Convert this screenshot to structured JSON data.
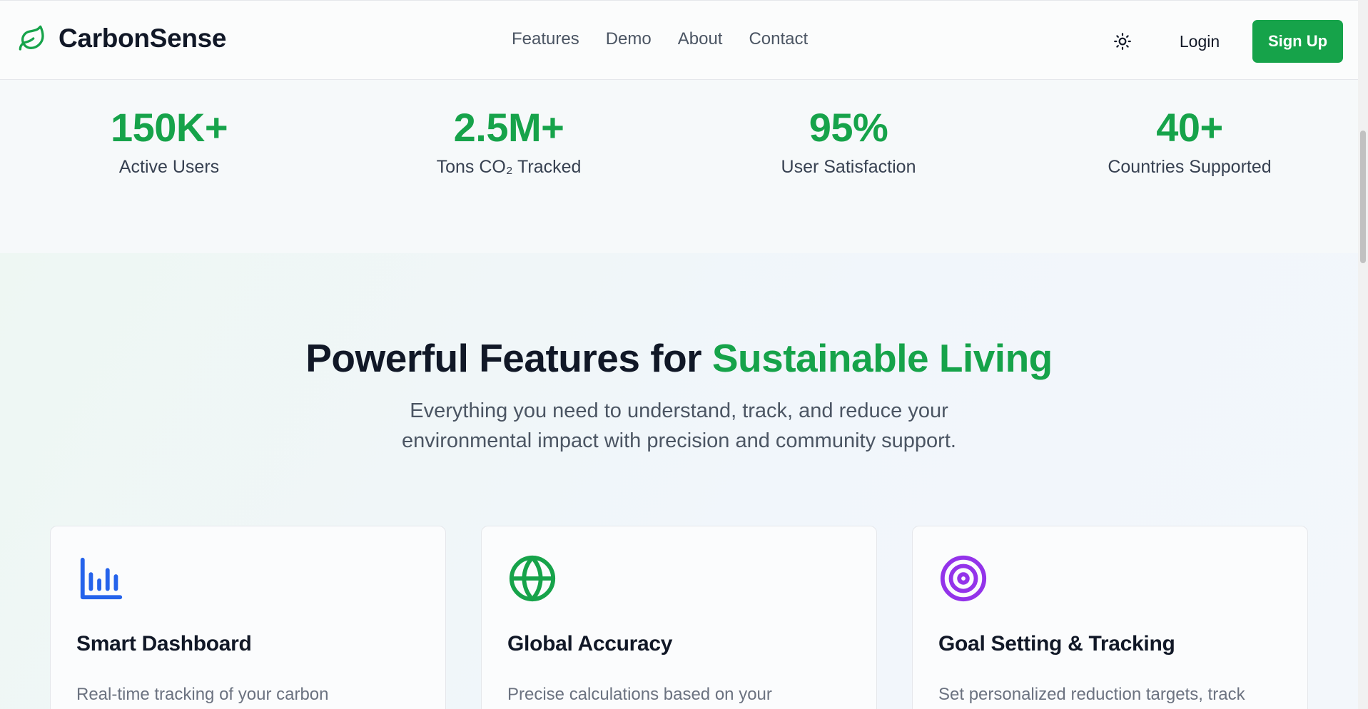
{
  "brand": {
    "name": "CarbonSense",
    "icon": "leaf-icon"
  },
  "nav": {
    "links": [
      "Features",
      "Demo",
      "About",
      "Contact"
    ],
    "theme_icon": "sun-icon",
    "login_label": "Login",
    "signup_label": "Sign Up"
  },
  "stats": [
    {
      "value": "150K+",
      "label": "Active Users"
    },
    {
      "value": "2.5M+",
      "label": "Tons CO₂ Tracked"
    },
    {
      "value": "95%",
      "label": "User Satisfaction"
    },
    {
      "value": "40+",
      "label": "Countries Supported"
    }
  ],
  "features": {
    "heading_main": "Powerful Features for ",
    "heading_accent": "Sustainable Living",
    "subtitle": "Everything you need to understand, track, and reduce your environmental impact with precision and community support.",
    "cards": [
      {
        "icon": "bar-chart-icon",
        "title": "Smart Dashboard",
        "desc": "Real-time tracking of your carbon"
      },
      {
        "icon": "globe-icon",
        "title": "Global Accuracy",
        "desc": "Precise calculations based on your"
      },
      {
        "icon": "target-icon",
        "title": "Goal Setting & Tracking",
        "desc": "Set personalized reduction targets, track"
      }
    ]
  },
  "colors": {
    "accent": "#16a34a",
    "chart_icon": "#2563eb",
    "globe_icon": "#16a34a",
    "target_icon": "#9333ea"
  }
}
